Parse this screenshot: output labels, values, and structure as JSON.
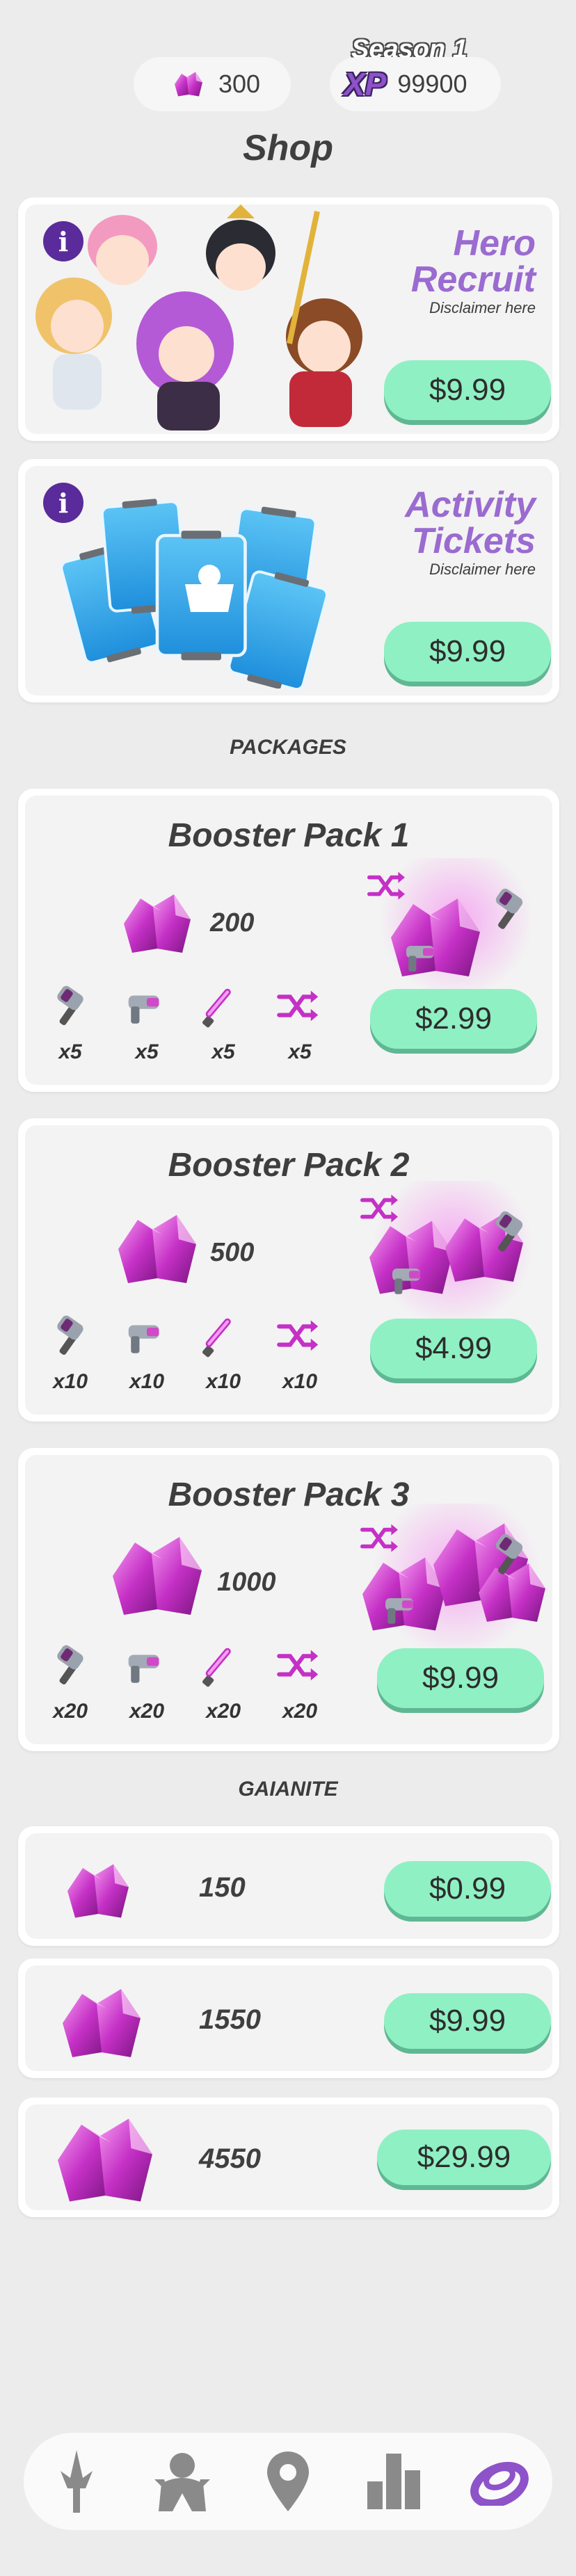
{
  "header": {
    "gems": "300",
    "season": "Season 1",
    "xp_label": "XP",
    "xp": "99900"
  },
  "title": "Shop",
  "featured": [
    {
      "title_line1": "Hero",
      "title_line2": "Recruit",
      "disclaimer": "Disclaimer here",
      "price": "$9.99"
    },
    {
      "title_line1": "Activity",
      "title_line2": "Tickets",
      "disclaimer": "Disclaimer here",
      "price": "$9.99"
    }
  ],
  "packages_heading": "PACKAGES",
  "packages": [
    {
      "title": "Booster Pack 1",
      "amount": "200",
      "items": [
        "x5",
        "x5",
        "x5",
        "x5"
      ],
      "price": "$2.99"
    },
    {
      "title": "Booster Pack 2",
      "amount": "500",
      "items": [
        "x10",
        "x10",
        "x10",
        "x10"
      ],
      "price": "$4.99"
    },
    {
      "title": "Booster Pack 3",
      "amount": "1000",
      "items": [
        "x20",
        "x20",
        "x20",
        "x20"
      ],
      "price": "$9.99"
    }
  ],
  "gaianite_heading": "GAIANITE",
  "gaianite": [
    {
      "amount": "150",
      "price": "$0.99"
    },
    {
      "amount": "1550",
      "price": "$9.99"
    },
    {
      "amount": "4550",
      "price": "$29.99"
    }
  ],
  "nav": [
    {
      "icon": "sword-icon"
    },
    {
      "icon": "heroes-icon"
    },
    {
      "icon": "map-pin-icon"
    },
    {
      "icon": "leaderboard-icon"
    },
    {
      "icon": "shop-icon",
      "active": true
    }
  ],
  "colors": {
    "accent": "#9a6bd0",
    "button": "#8ff0c4",
    "gem": "#c23ec9",
    "nav_active": "#8e52c9",
    "nav_inactive": "#8a8a8a"
  }
}
